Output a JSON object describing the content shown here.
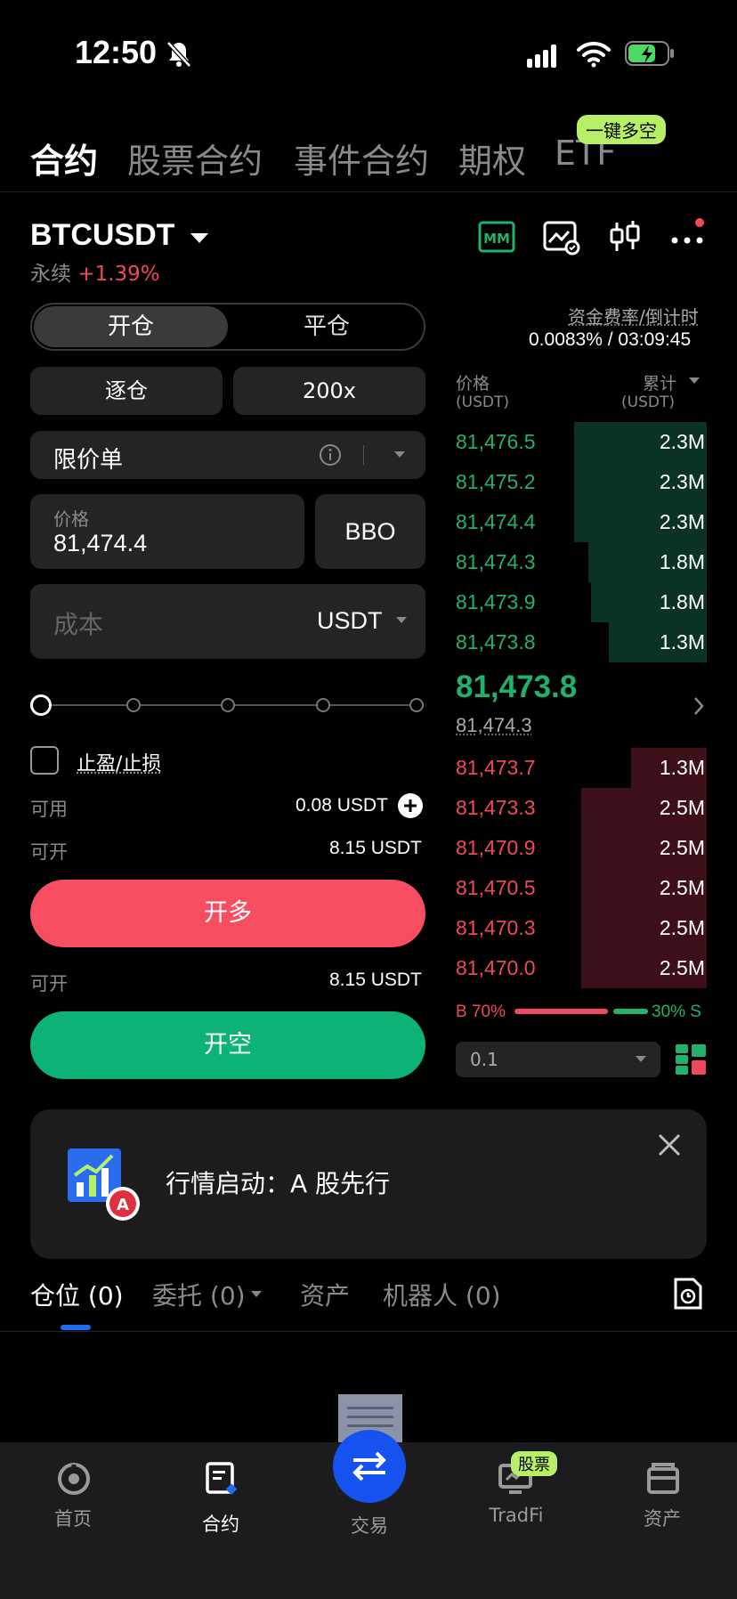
{
  "status": {
    "time": "12:50"
  },
  "topnav": {
    "tabs": [
      "合约",
      "股票合约",
      "事件合约",
      "期权",
      "ETF"
    ],
    "badge": "一键多空"
  },
  "header": {
    "symbol": "BTCUSDT",
    "type": "永续",
    "change": "+1.39%"
  },
  "order": {
    "open_label": "开仓",
    "close_label": "平仓",
    "margin_mode": "逐仓",
    "leverage": "200x",
    "order_type": "限价单",
    "price_label": "价格",
    "price_value": "81,474.4",
    "bbo_label": "BBO",
    "cost_placeholder": "成本",
    "cost_unit": "USDT",
    "tpsl_label": "止盈/止损",
    "available_label": "可用",
    "available_value": "0.08 USDT",
    "max_open_label": "可开",
    "max_open_long": "8.15 USDT",
    "long_button": "开多",
    "max_open_short": "8.15 USDT",
    "short_button": "开空"
  },
  "funding": {
    "label": "资金费率/倒计时",
    "value": "0.0083% / 03:09:45"
  },
  "orderbook": {
    "price_header": "价格",
    "price_unit": "(USDT)",
    "qty_header": "累计",
    "qty_unit": "(USDT)",
    "asks": [
      {
        "price": "81,476.5",
        "qty": "2.3M",
        "depth": 0.53
      },
      {
        "price": "81,475.2",
        "qty": "2.3M",
        "depth": 0.53
      },
      {
        "price": "81,474.4",
        "qty": "2.3M",
        "depth": 0.53
      },
      {
        "price": "81,474.3",
        "qty": "1.8M",
        "depth": 0.47
      },
      {
        "price": "81,473.9",
        "qty": "1.8M",
        "depth": 0.46
      },
      {
        "price": "81,473.8",
        "qty": "1.3M",
        "depth": 0.39
      }
    ],
    "last_price": "81,473.8",
    "mark_price": "81,474.3",
    "bids": [
      {
        "price": "81,473.7",
        "qty": "1.3M",
        "depth": 0.3
      },
      {
        "price": "81,473.3",
        "qty": "2.5M",
        "depth": 0.5
      },
      {
        "price": "81,470.9",
        "qty": "2.5M",
        "depth": 0.5
      },
      {
        "price": "81,470.5",
        "qty": "2.5M",
        "depth": 0.5
      },
      {
        "price": "81,470.3",
        "qty": "2.5M",
        "depth": 0.5
      },
      {
        "price": "81,470.0",
        "qty": "2.5M",
        "depth": 0.5
      }
    ],
    "buy_ratio_label": "B 70%",
    "sell_ratio_label": "30% S",
    "buy_ratio": 0.7,
    "precision": "0.1"
  },
  "banner": {
    "text": "行情启动：A 股先行",
    "icon_letter": "A"
  },
  "tabs": [
    {
      "label": "仓位",
      "count": "(0)"
    },
    {
      "label": "委托",
      "count": "(0)"
    },
    {
      "label": "资产",
      "count": ""
    },
    {
      "label": "机器人",
      "count": "(0)"
    }
  ],
  "bottom_nav": {
    "home": "首页",
    "futures": "合约",
    "trade": "交易",
    "tradfi": "TradFi",
    "tradfi_badge": "股票",
    "assets": "资产"
  },
  "colors": {
    "green": "#20b26c",
    "red": "#f0485b",
    "accent": "#1652f0"
  }
}
